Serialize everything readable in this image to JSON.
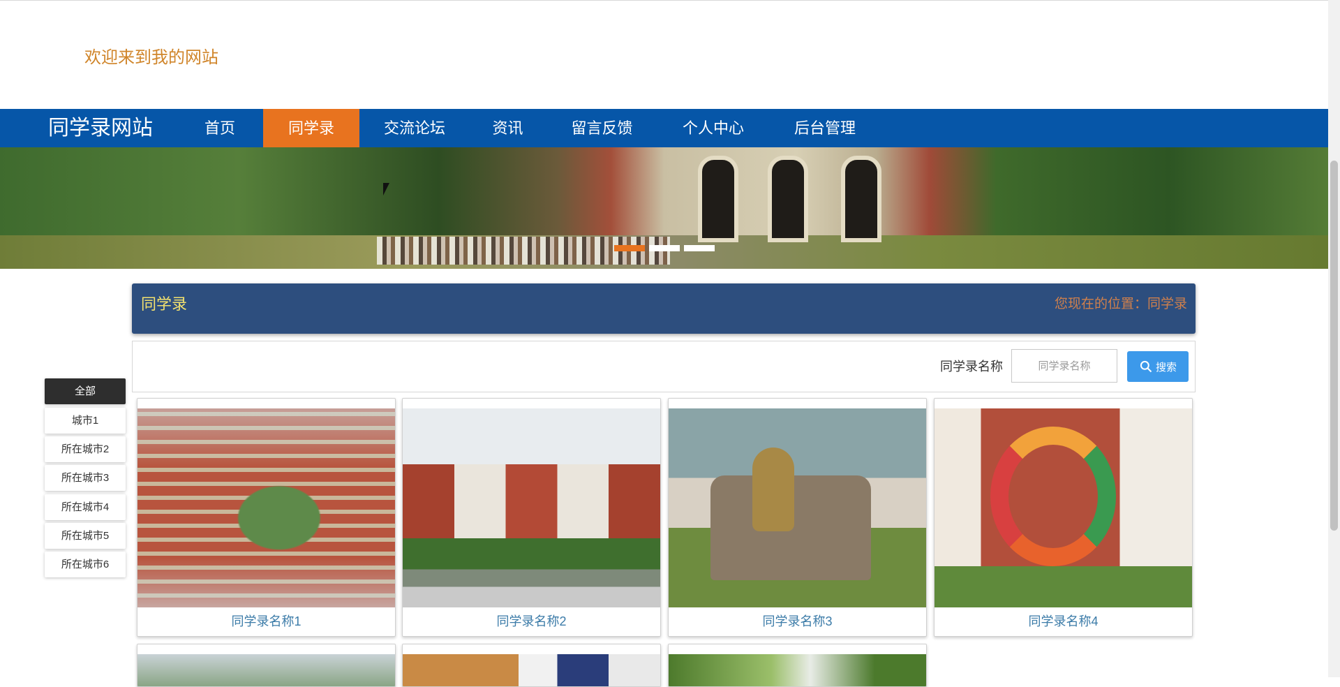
{
  "header": {
    "welcome": "欢迎来到我的网站"
  },
  "nav": {
    "brand": "同学录网站",
    "items": [
      {
        "label": "首页",
        "active": false
      },
      {
        "label": "同学录",
        "active": true
      },
      {
        "label": "交流论坛",
        "active": false
      },
      {
        "label": "资讯",
        "active": false
      },
      {
        "label": "留言反馈",
        "active": false
      },
      {
        "label": "个人中心",
        "active": false
      },
      {
        "label": "后台管理",
        "active": false
      }
    ]
  },
  "banner": {
    "slide_count": 3,
    "active_slide": 1
  },
  "page": {
    "title": "同学录",
    "breadcrumb": "您现在的位置：同学录"
  },
  "search": {
    "label": "同学录名称",
    "placeholder": "同学录名称",
    "value": "",
    "button_label": "搜索"
  },
  "sidebar": {
    "items": [
      {
        "label": "全部",
        "active": true
      },
      {
        "label": "城市1",
        "active": false
      },
      {
        "label": "所在城市2",
        "active": false
      },
      {
        "label": "所在城市3",
        "active": false
      },
      {
        "label": "所在城市4",
        "active": false
      },
      {
        "label": "所在城市5",
        "active": false
      },
      {
        "label": "所在城市6",
        "active": false
      }
    ]
  },
  "cards": [
    {
      "name": "同学录名称1"
    },
    {
      "name": "同学录名称2"
    },
    {
      "name": "同学录名称3"
    },
    {
      "name": "同学录名称4"
    }
  ],
  "colors": {
    "nav_bg": "#0656a8",
    "nav_active": "#e8731f",
    "title_bar": "#2d4e7e",
    "title_text": "#f4e26e",
    "breadcrumb": "#d0804c",
    "search_button": "#3c99ea",
    "card_name": "#3b7ba8",
    "welcome": "#d0852a"
  }
}
